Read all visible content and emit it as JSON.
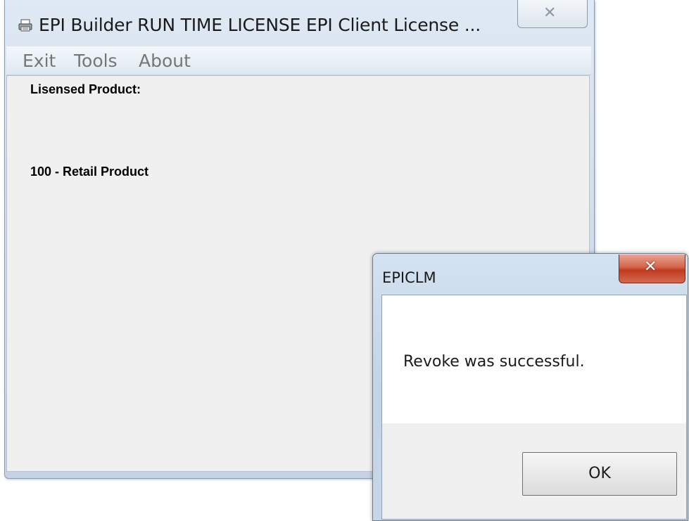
{
  "main_window": {
    "title": "EPI Builder RUN TIME LICENSE EPI Client License ...",
    "menu": [
      "Exit",
      "Tools",
      "About"
    ],
    "content": {
      "label": "Lisensed Product:",
      "product": "100 - Retail Product"
    }
  },
  "dialog": {
    "title": "EPICLM",
    "message": "Revoke was successful.",
    "ok_label": "OK"
  }
}
